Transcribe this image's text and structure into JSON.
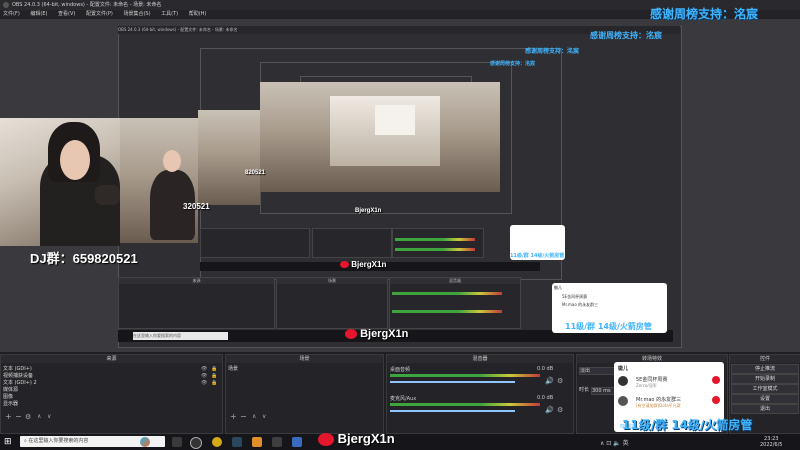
{
  "window": {
    "title": "OBS 24.0.3 (64-bit, windows) - 配置文件: 未命名 - 场景: 未命名"
  },
  "menu": [
    "文件(F)",
    "编辑(E)",
    "查看(V)",
    "配置文件(P)",
    "场景集合(S)",
    "工具(T)",
    "帮助(H)"
  ],
  "overlay": {
    "thanks": "感谢周榜支持：洺宸",
    "dj_group": "DJ群：659820521",
    "dj_partial": "820521",
    "dj_partial2": "320521",
    "weibo_handle": "BjergX1n",
    "level_banner": "11级/群 14级/火箭房管"
  },
  "chat": {
    "header": "徽儿",
    "messages": [
      {
        "user": "5E金同杯周赛",
        "text": "Zerco/冠军"
      },
      {
        "user": "Mr.mao 的永友群三",
        "text": "[有空请加群]Dota平凡赛"
      }
    ],
    "button": "加载全部"
  },
  "docks": {
    "scenes": {
      "title": "场景",
      "items": []
    },
    "sources": {
      "title": "来源",
      "items": [
        "文本 (GDI+)",
        "视频捕获设备",
        "文本 (GDI+) 2",
        "媒体源",
        "图像",
        "显示器"
      ]
    },
    "mixer": {
      "title": "混音器",
      "tracks": [
        {
          "name": "桌面音频",
          "db": "0.0 dB"
        },
        {
          "name": "麦克风/Aux",
          "db": "0.0 dB"
        }
      ]
    },
    "transitions": {
      "title": "转场特效",
      "type": "淡出",
      "duration_label": "时长",
      "duration_value": "300 ms"
    },
    "controls": {
      "title": "控件",
      "buttons": [
        "停止推流",
        "开始录制",
        "工作室模式",
        "设置",
        "退出"
      ]
    },
    "scene_panel_label": "场景"
  },
  "taskbar": {
    "search_placeholder": "在这里输入你要搜索的内容",
    "time": "23:23",
    "date": "2022/6/5"
  },
  "colors": {
    "accent_blue": "#3fb4ff",
    "chat_green": "#2bb673",
    "weibo_red": "#e6162d"
  }
}
